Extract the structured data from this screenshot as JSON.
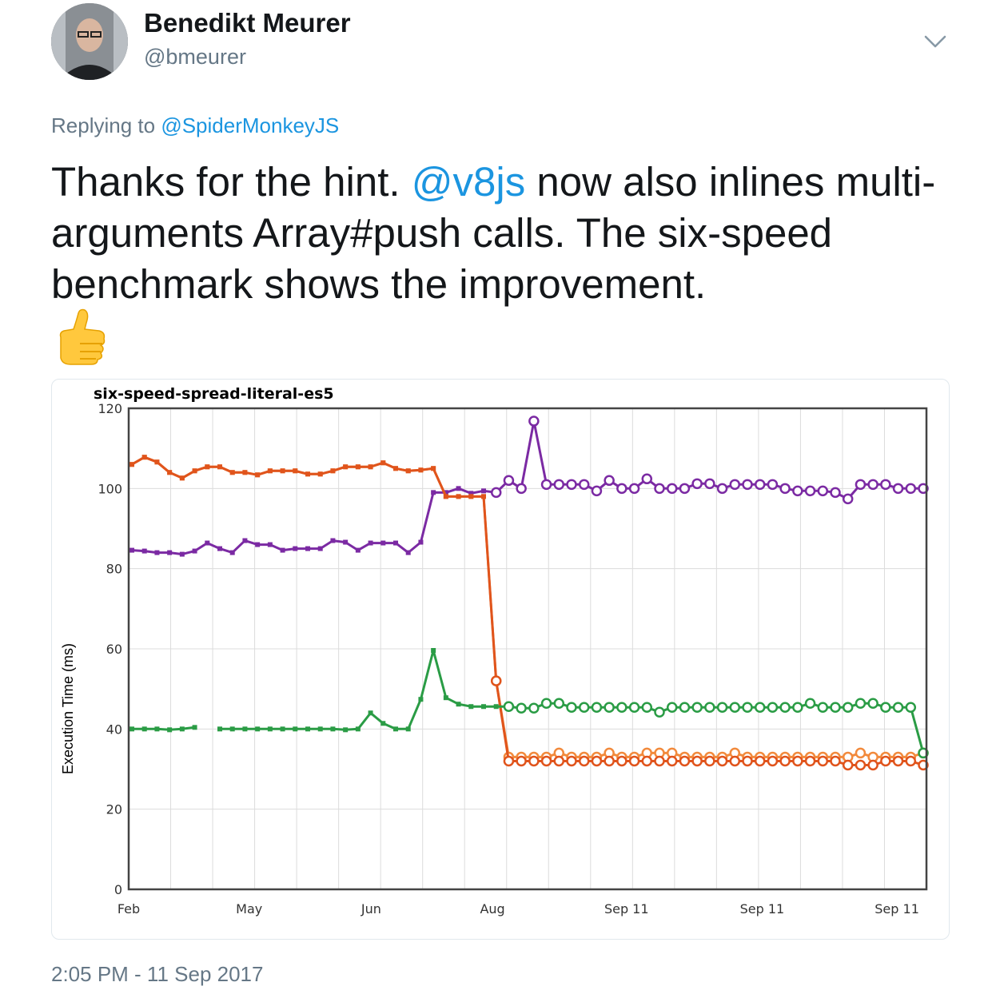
{
  "author": {
    "name": "Benedikt Meurer",
    "handle": "@bmeurer"
  },
  "reply": {
    "prefix": "Replying to ",
    "mention": "@SpiderMonkeyJS"
  },
  "tweet": {
    "part1": "Thanks for the hint. ",
    "mention": "@v8js",
    "part2": " now also inlines multi-arguments Array#push calls. The six-speed benchmark shows the improvement.",
    "emoji": "thumbs-up"
  },
  "timestamp": "2:05 PM - 11 Sep 2017",
  "icons": {
    "menu": "chevron-down-icon",
    "avatar": "avatar"
  },
  "colors": {
    "link": "#1b95e0",
    "muted": "#657786",
    "purple": "#7b2aa3",
    "orange": "#f28a3c",
    "dark_orange": "#e0541c",
    "green": "#2a9c45"
  },
  "chart_data": {
    "type": "line",
    "title": "six-speed-spread-literal-es5",
    "ylabel": "Execution Time (ms)",
    "xlabel": "",
    "ylim": [
      0,
      120
    ],
    "yticks": [
      0,
      20,
      40,
      60,
      80,
      100,
      120
    ],
    "x_tick_labels": [
      "Feb",
      "May",
      "Jun",
      "Aug",
      "Sep 11",
      "Sep 11",
      "Sep 11"
    ],
    "grid": true,
    "series": [
      {
        "color": "#7b2aa3",
        "values": [
          84.6,
          84.4,
          84,
          84,
          83.6,
          84.4,
          86.4,
          85,
          84,
          87,
          86,
          86,
          84.6,
          85,
          85,
          85,
          87,
          86.6,
          84.6,
          86.4,
          86.4,
          86.4,
          84,
          86.6,
          99,
          99,
          100,
          98.8,
          99.4,
          99,
          102,
          100,
          116.8,
          101,
          101,
          101,
          101,
          99.4,
          102,
          100,
          100,
          102.4,
          100,
          100,
          100,
          101.2,
          101.2,
          100,
          101,
          101,
          101,
          101,
          100,
          99.4,
          99.4,
          99.4,
          99,
          97.4,
          101,
          101,
          101,
          100,
          100,
          100
        ]
      },
      {
        "color": "#f28a3c",
        "values": [
          106,
          107.8,
          106.6,
          104,
          102.6,
          104.4,
          105.4,
          105.4,
          104,
          104,
          103.4,
          104.4,
          104.4,
          104.4,
          103.6,
          103.6,
          104.4,
          105.4,
          105.4,
          105.4,
          106.4,
          105,
          104.4,
          104.6,
          105,
          98,
          98,
          98,
          98,
          52,
          33,
          33,
          33,
          33,
          34,
          33,
          33,
          33,
          34,
          33,
          33,
          34,
          34,
          34,
          33,
          33,
          33,
          33,
          34,
          33,
          33,
          33,
          33,
          33,
          33,
          33,
          33,
          33,
          34,
          33,
          33,
          33,
          33,
          34
        ]
      },
      {
        "color": "#e0541c",
        "values": [
          106,
          107.8,
          106.6,
          104,
          102.6,
          104.4,
          105.4,
          105.4,
          104,
          104,
          103.4,
          104.4,
          104.4,
          104.4,
          103.6,
          103.6,
          104.4,
          105.4,
          105.4,
          105.4,
          106.4,
          105,
          104.4,
          104.6,
          105,
          98,
          98,
          98,
          98,
          52,
          32,
          32,
          32,
          32,
          32,
          32,
          32,
          32,
          32,
          32,
          32,
          32,
          32,
          32,
          32,
          32,
          32,
          32,
          32,
          32,
          32,
          32,
          32,
          32,
          32,
          32,
          32,
          31,
          31,
          31,
          32,
          32,
          32,
          31
        ]
      },
      {
        "color": "#2a9c45",
        "values": [
          40,
          40,
          40,
          39.8,
          40,
          40.4,
          null,
          40,
          40,
          40,
          40,
          40,
          40,
          40,
          40,
          40,
          40,
          39.8,
          40,
          44,
          41.4,
          40,
          40,
          47.4,
          59.6,
          47.8,
          46.2,
          45.6,
          45.6,
          45.6,
          45.6,
          45.2,
          45.2,
          46.4,
          46.4,
          45.4,
          45.4,
          45.4,
          45.4,
          45.4,
          45.4,
          45.4,
          44.2,
          45.4,
          45.4,
          45.4,
          45.4,
          45.4,
          45.4,
          45.4,
          45.4,
          45.4,
          45.4,
          45.4,
          46.4,
          45.4,
          45.4,
          45.4,
          46.4,
          46.4,
          45.4,
          45.4,
          45.4,
          34
        ]
      }
    ],
    "open_marker_start_index": [
      29,
      29,
      29,
      30
    ]
  }
}
